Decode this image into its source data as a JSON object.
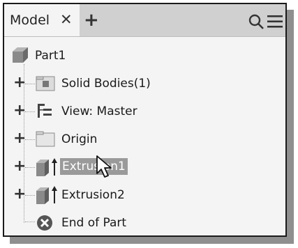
{
  "tabs": [
    {
      "label": "Model",
      "close_glyph": "✕"
    }
  ],
  "add_tab_glyph": "+",
  "toolbar_icons": [
    "search-icon",
    "menu-icon"
  ],
  "tree": {
    "root": {
      "label": "Part1",
      "icon": "part-icon"
    },
    "items": [
      {
        "label": "Solid Bodies(1)",
        "icon": "solid-bodies-folder-icon",
        "expander": "+"
      },
      {
        "label": "View: Master",
        "icon": "view-icon",
        "expander": "+"
      },
      {
        "label": "Origin",
        "icon": "folder-icon",
        "expander": "+"
      },
      {
        "label": "Extrusion1",
        "icon": "extrusion-icon",
        "expander": "+",
        "selected": true
      },
      {
        "label": "Extrusion2",
        "icon": "extrusion-icon",
        "expander": "+"
      },
      {
        "label": "End of Part",
        "icon": "end-of-part-icon"
      }
    ]
  },
  "colors": {
    "selection": "#9a9a9a",
    "tabbar": "#d0d0d0",
    "panel": "#f4f4f4"
  }
}
